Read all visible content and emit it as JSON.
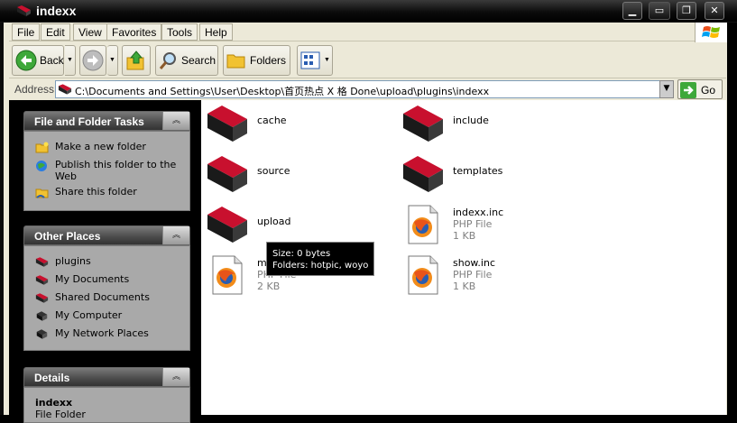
{
  "window": {
    "title": "indexx",
    "controls": [
      "minimize-icon",
      "restore-icon",
      "close-icon"
    ]
  },
  "menubar": {
    "items": [
      "File",
      "Edit",
      "View",
      "Favorites",
      "Tools",
      "Help"
    ]
  },
  "toolbar": {
    "back_label": "Back",
    "search_label": "Search",
    "folders_label": "Folders"
  },
  "address": {
    "label": "Address",
    "path": "C:\\Documents and Settings\\User\\Desktop\\首页热点 X 格 Done\\upload\\plugins\\indexx",
    "go_label": "Go"
  },
  "sidebar": {
    "tasks": {
      "title": "File and Folder Tasks",
      "items": [
        {
          "label": "Make a new folder",
          "icon": "new-folder-icon"
        },
        {
          "label": "Publish this folder to the",
          "label2": "Web",
          "icon": "publish-web-icon"
        },
        {
          "label": "Share this folder",
          "icon": "share-folder-icon"
        }
      ]
    },
    "other_places": {
      "title": "Other Places",
      "items": [
        {
          "label": "plugins",
          "icon": "folder-icon"
        },
        {
          "label": "My Documents",
          "icon": "folder-icon"
        },
        {
          "label": "Shared Documents",
          "icon": "folder-icon"
        },
        {
          "label": "My Computer",
          "icon": "computer-icon"
        },
        {
          "label": "My Network Places",
          "icon": "network-icon"
        }
      ]
    },
    "details": {
      "title": "Details",
      "name": "indexx",
      "type": "File Folder"
    }
  },
  "files": [
    {
      "name": "cache",
      "kind": "folder"
    },
    {
      "name": "include",
      "kind": "folder"
    },
    {
      "name": "source",
      "kind": "folder"
    },
    {
      "name": "templates",
      "kind": "folder"
    },
    {
      "name": "upload",
      "kind": "folder"
    },
    {
      "name": "indexx.inc",
      "kind": "php",
      "type": "PHP File",
      "size": "1 KB"
    },
    {
      "name": "mo",
      "kind": "php",
      "type": "PHP File",
      "size": "2 KB"
    },
    {
      "name": "show.inc",
      "kind": "php",
      "type": "PHP File",
      "size": "1 KB"
    }
  ],
  "tooltip": {
    "line1": "Size: 0 bytes",
    "line2": "Folders: hotpic, woyo"
  },
  "colors": {
    "folder_tab": "#c8102e",
    "folder_body": "#1a1a1a",
    "panel_bg": "#a9a9a9",
    "frame": "#ece9d8"
  }
}
